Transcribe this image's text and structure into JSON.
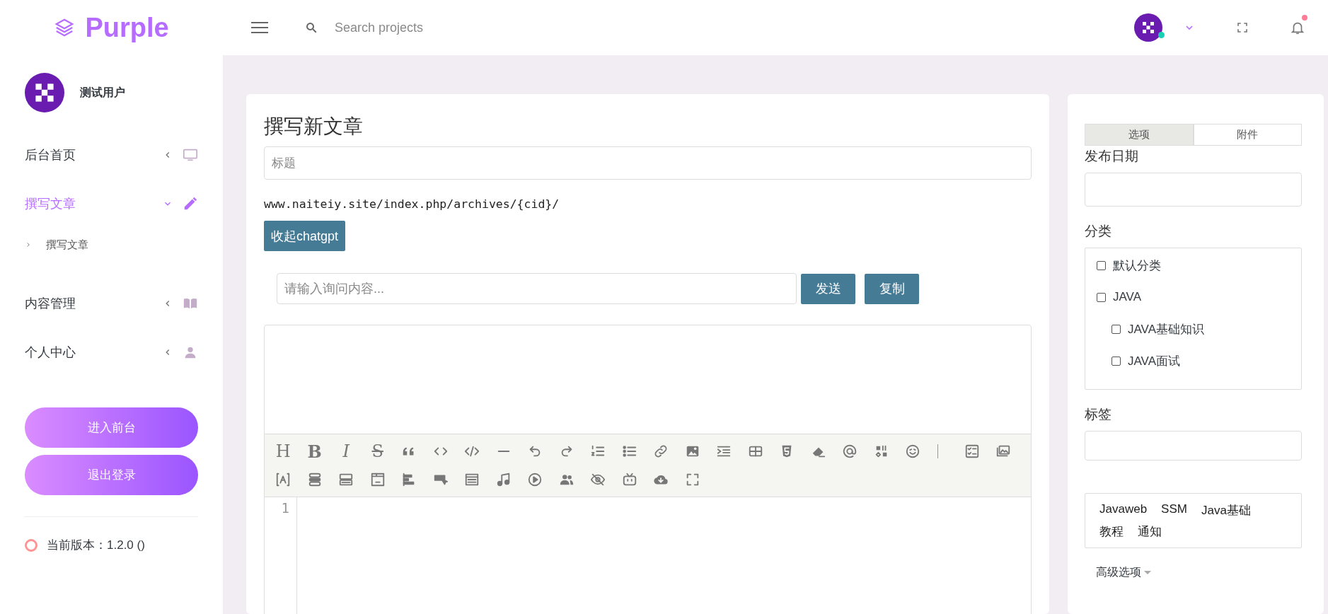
{
  "brand": {
    "name": "Purple"
  },
  "search": {
    "placeholder": "Search projects"
  },
  "user": {
    "name": "测试用户"
  },
  "sidebar": {
    "items": [
      {
        "label": "后台首页",
        "selected": false,
        "expanded": false
      },
      {
        "label": "撰写文章",
        "selected": true,
        "expanded": true,
        "children": [
          {
            "label": "撰写文章"
          }
        ]
      },
      {
        "label": "内容管理",
        "selected": false,
        "expanded": false
      },
      {
        "label": "个人中心",
        "selected": false,
        "expanded": false
      }
    ],
    "buttons": [
      "进入前台",
      "退出登录"
    ],
    "version": "当前版本：1.2.0 ()"
  },
  "editor": {
    "heading": "撰写新文章",
    "title_field": {
      "placeholder": "标题"
    },
    "permalink": "www.naiteiy.site/index.php/archives/{cid}/",
    "chatgpt_toggle": "收起chatgpt",
    "chat": {
      "placeholder": "请输入询问内容...",
      "buttons": [
        "发送",
        "复制"
      ]
    },
    "toolbar_glyphs": [
      {
        "text": "H",
        "kind": "heading"
      },
      {
        "text": "B",
        "kind": "bold"
      },
      {
        "text": "I",
        "kind": "italic"
      },
      {
        "text": "S",
        "kind": "strike"
      }
    ],
    "line_numbers": [
      "1"
    ]
  },
  "options": {
    "tabs": [
      {
        "label": "选项",
        "selected": true
      },
      {
        "label": "附件",
        "selected": false
      }
    ],
    "publish_date": {
      "label": "发布日期"
    },
    "category": {
      "label": "分类",
      "items": [
        {
          "label": "默认分类",
          "checked": false
        },
        {
          "label": "JAVA",
          "checked": false,
          "children": [
            {
              "label": "JAVA基础知识",
              "checked": false
            },
            {
              "label": "JAVA面试",
              "checked": false
            }
          ]
        }
      ]
    },
    "tags": {
      "label": "标签",
      "suggestions": [
        "Javaweb",
        "SSM",
        "Java基础",
        "教程",
        "通知"
      ]
    },
    "advanced": {
      "label": "高级选项",
      "expanded": false
    }
  }
}
